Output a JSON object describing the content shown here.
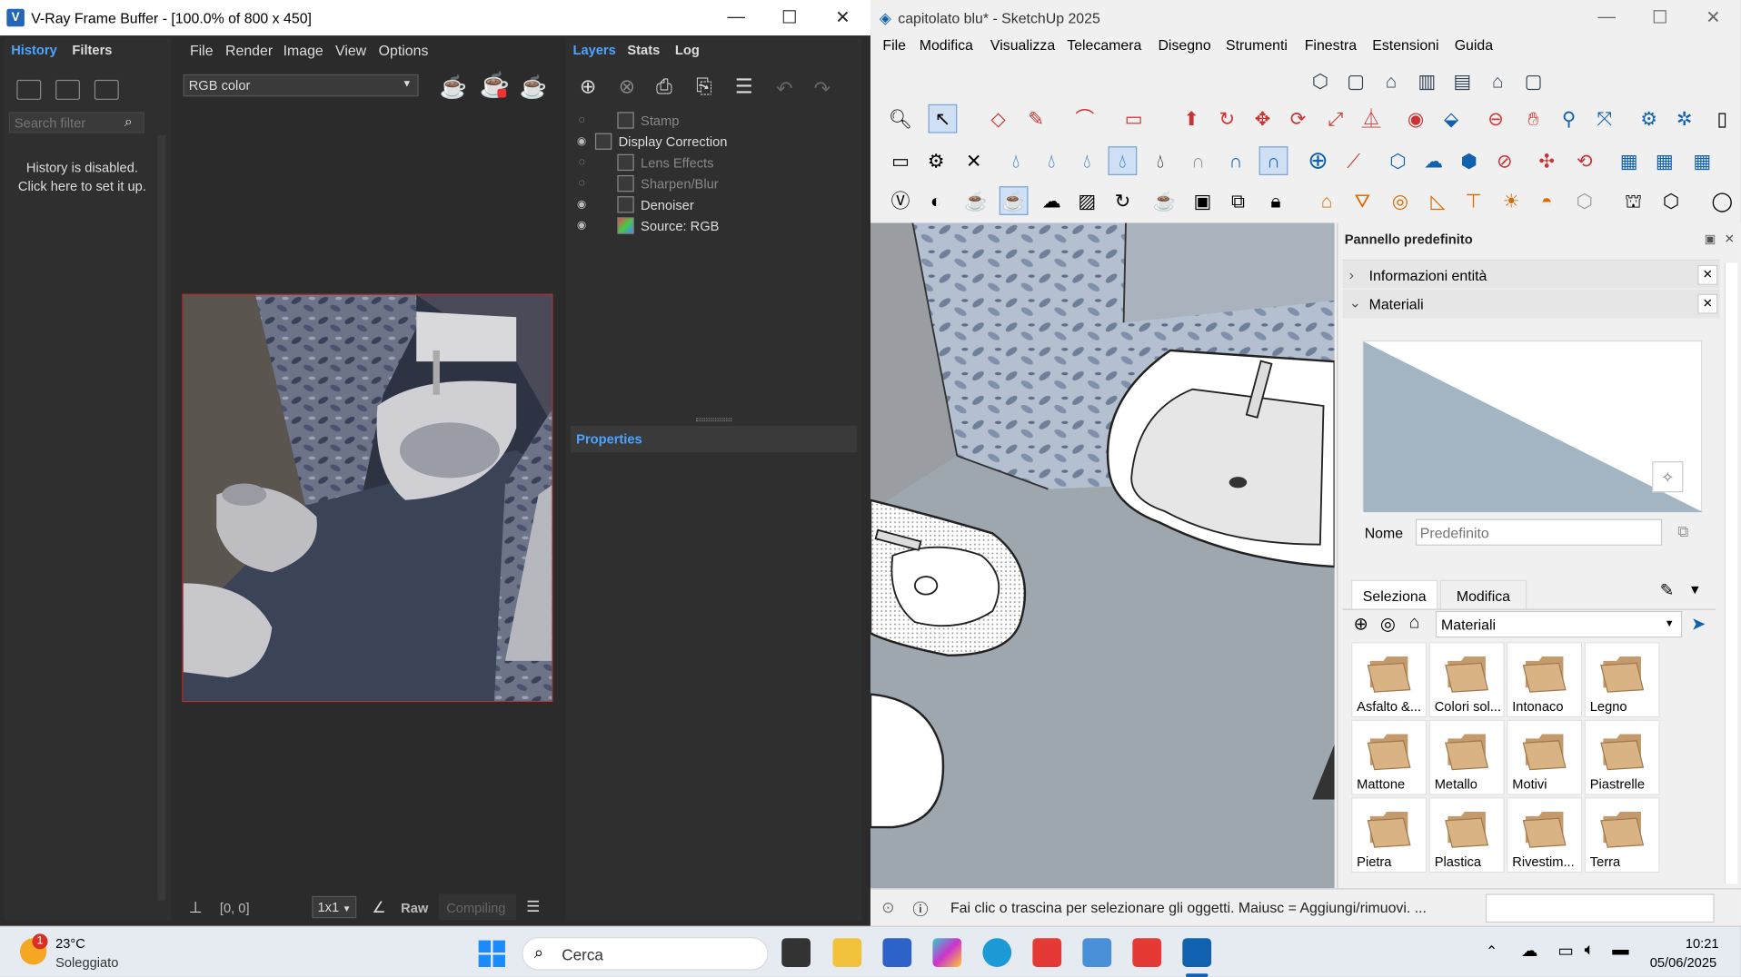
{
  "vray": {
    "title": "V-Ray Frame Buffer - [100.0% of 800 x 450]",
    "tabs_left": [
      "History",
      "Filters"
    ],
    "search_placeholder": "Search filter",
    "history_msg_1": "History is disabled.",
    "history_msg_2": "Click here to set it up.",
    "menu": [
      "File",
      "Render",
      "Image",
      "View",
      "Options"
    ],
    "channel": "RGB color",
    "tabs_right": [
      "Layers",
      "Stats",
      "Log"
    ],
    "layers": [
      {
        "name": "Stamp",
        "visible": false
      },
      {
        "name": "Display Correction",
        "visible": true
      },
      {
        "name": "Lens Effects",
        "visible": false
      },
      {
        "name": "Sharpen/Blur",
        "visible": false
      },
      {
        "name": "Denoiser",
        "visible": true
      },
      {
        "name": "Source: RGB",
        "visible": true
      }
    ],
    "properties_label": "Properties",
    "coords": "[0, 0]",
    "ratio": "1x1",
    "raw": "Raw",
    "compiling": "Compiling"
  },
  "sketchup": {
    "title": "capitolato blu* - SketchUp 2025",
    "menu": [
      "File",
      "Modifica",
      "Visualizza",
      "Telecamera",
      "Disegno",
      "Strumenti",
      "Finestra",
      "Estensioni",
      "Guida"
    ],
    "tray_title": "Pannello predefinito",
    "entity_info": "Informazioni entità",
    "materials": "Materiali",
    "name_label": "Nome",
    "name_placeholder": "Predefinito",
    "tab_select": "Seleziona",
    "tab_edit": "Modifica",
    "collection": "Materiali",
    "material_folders": [
      "Asfalto &...",
      "Colori sol...",
      "Intonaco",
      "Legno",
      "Mattone",
      "Metallo",
      "Motivi",
      "Piastrelle",
      "Pietra",
      "Plastica",
      "Rivestim...",
      "Terra"
    ],
    "status": "Fai clic o trascina per selezionare gli oggetti. Maiusc = Aggiungi/rimuovi. ..."
  },
  "taskbar": {
    "temp": "23°C",
    "weather": "Soleggiato",
    "weather_badge": "1",
    "search": "Cerca",
    "time": "10:21",
    "date": "05/06/2025"
  }
}
